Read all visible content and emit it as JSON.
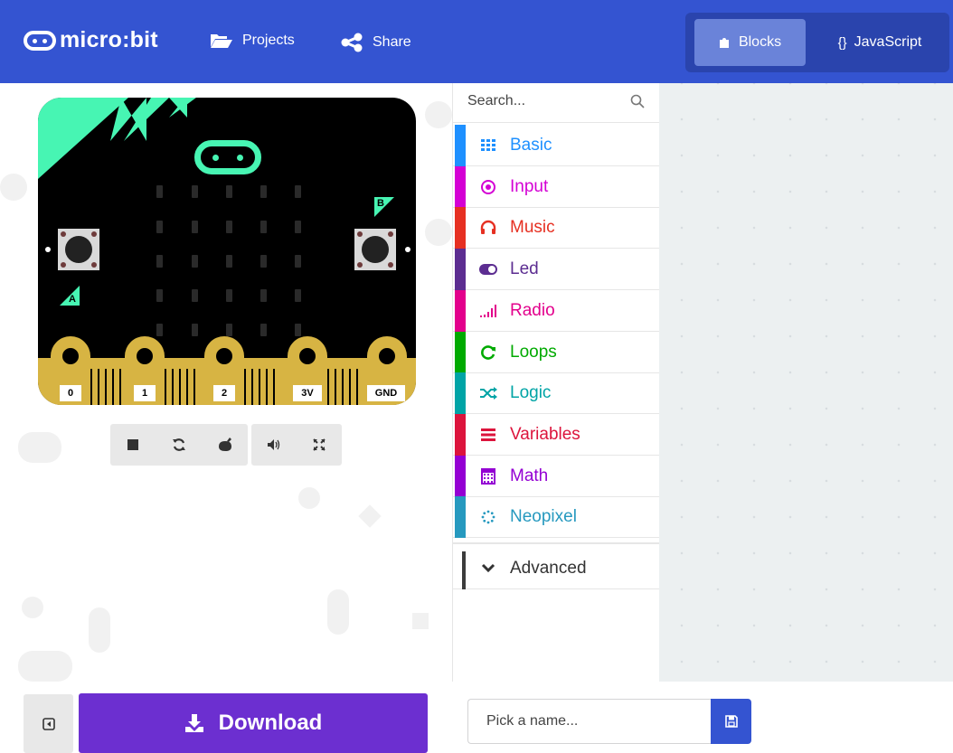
{
  "header": {
    "logo_text": "micro:bit",
    "projects_label": "Projects",
    "share_label": "Share",
    "blocks_label": "Blocks",
    "javascript_label": "JavaScript",
    "js_icon": "{}"
  },
  "simulator": {
    "button_a": "A",
    "button_b": "B",
    "pins": [
      "0",
      "1",
      "2",
      "3V",
      "GND"
    ],
    "controls": [
      "stop-icon",
      "restart-icon",
      "debug-icon",
      "mute-icon",
      "fullscreen-icon"
    ]
  },
  "toolbox": {
    "search_placeholder": "Search...",
    "categories": [
      {
        "label": "Basic",
        "color": "#1e90ff",
        "icon": "grid-icon"
      },
      {
        "label": "Input",
        "color": "#d400d4",
        "icon": "target-icon"
      },
      {
        "label": "Music",
        "color": "#e63022",
        "icon": "headphones-icon"
      },
      {
        "label": "Led",
        "color": "#5c2d91",
        "icon": "toggle-icon"
      },
      {
        "label": "Radio",
        "color": "#e3008c",
        "icon": "signal-icon"
      },
      {
        "label": "Loops",
        "color": "#00aa00",
        "icon": "refresh-icon"
      },
      {
        "label": "Logic",
        "color": "#00a4a6",
        "icon": "shuffle-icon"
      },
      {
        "label": "Variables",
        "color": "#dc143c",
        "icon": "list-icon"
      },
      {
        "label": "Math",
        "color": "#9400d3",
        "icon": "calculator-icon"
      },
      {
        "label": "Neopixel",
        "color": "#2699bf",
        "icon": "spinner-icon"
      }
    ],
    "advanced": {
      "label": "Advanced",
      "color": "#3c3c3c",
      "icon": "chevron-down-icon"
    }
  },
  "footer": {
    "download_label": "Download",
    "name_placeholder": "Pick a name..."
  }
}
